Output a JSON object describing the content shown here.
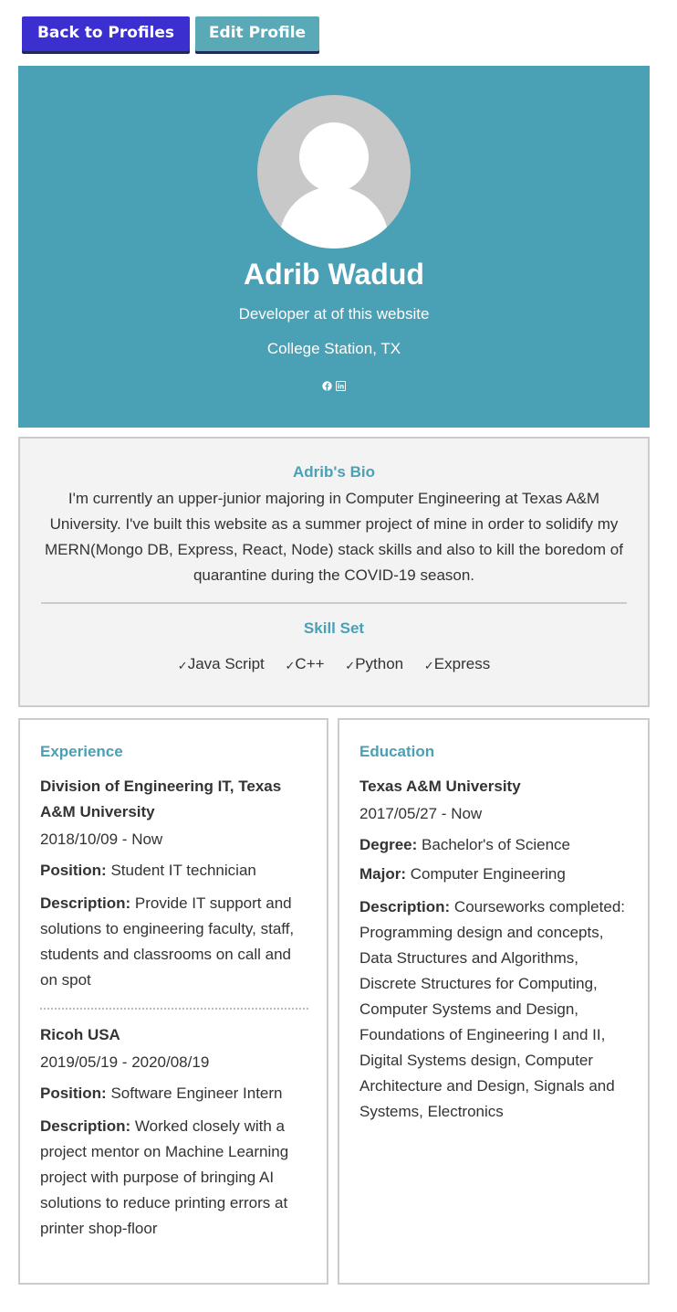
{
  "nav": {
    "back_label": "Back to Profiles",
    "edit_label": "Edit Profile"
  },
  "profile": {
    "name": "Adrib Wadud",
    "headline": "Developer at of this website",
    "location": "College Station, TX",
    "social_icons": [
      "facebook-icon",
      "linkedin-icon"
    ]
  },
  "bio": {
    "title": "Adrib's Bio",
    "text": "I'm currently an upper-junior majoring in Computer Engineering at Texas A&M University. I've built this website as a summer project of mine in order to solidify my MERN(Mongo DB, Express, React, Node) stack skills and also to kill the boredom of quarantine during the COVID-19 season.",
    "skills_title": "Skill Set",
    "skills": [
      "Java Script",
      "C++",
      "Python",
      "Express"
    ]
  },
  "experience": {
    "title": "Experience",
    "entries": [
      {
        "company": "Division of Engineering IT, Texas A&M University",
        "dates": "2018/10/09 - Now",
        "position_label": "Position:",
        "position": "Student IT technician",
        "description_label": "Description:",
        "description": "Provide IT support and solutions to engineering faculty, staff, students and classrooms on call and on spot"
      },
      {
        "company": "Ricoh USA",
        "dates": "2019/05/19 - 2020/08/19",
        "position_label": "Position:",
        "position": "Software Engineer Intern",
        "description_label": "Description:",
        "description": "Worked closely with a project mentor on Machine Learning project with purpose of bringing AI solutions to reduce printing errors at printer shop-floor"
      }
    ]
  },
  "education": {
    "title": "Education",
    "entries": [
      {
        "school": "Texas A&M University",
        "dates": "2017/05/27 - Now",
        "degree_label": "Degree:",
        "degree": "Bachelor's of Science",
        "major_label": "Major:",
        "major": "Computer Engineering",
        "description_label": "Description:",
        "description": "Courseworks completed: Programming design and concepts, Data Structures and Algorithms, Discrete Structures for Computing, Computer Systems and Design, Foundations of Engineering I and II, Digital Systems design, Computer Architecture and Design, Signals and Systems, Electronics"
      }
    ]
  },
  "colors": {
    "primary_button": "#3c2fd0",
    "secondary_button": "#5aa9b7",
    "banner": "#4aa0b5",
    "accent_text": "#4aa0b5",
    "bio_background": "#f3f3f3"
  }
}
